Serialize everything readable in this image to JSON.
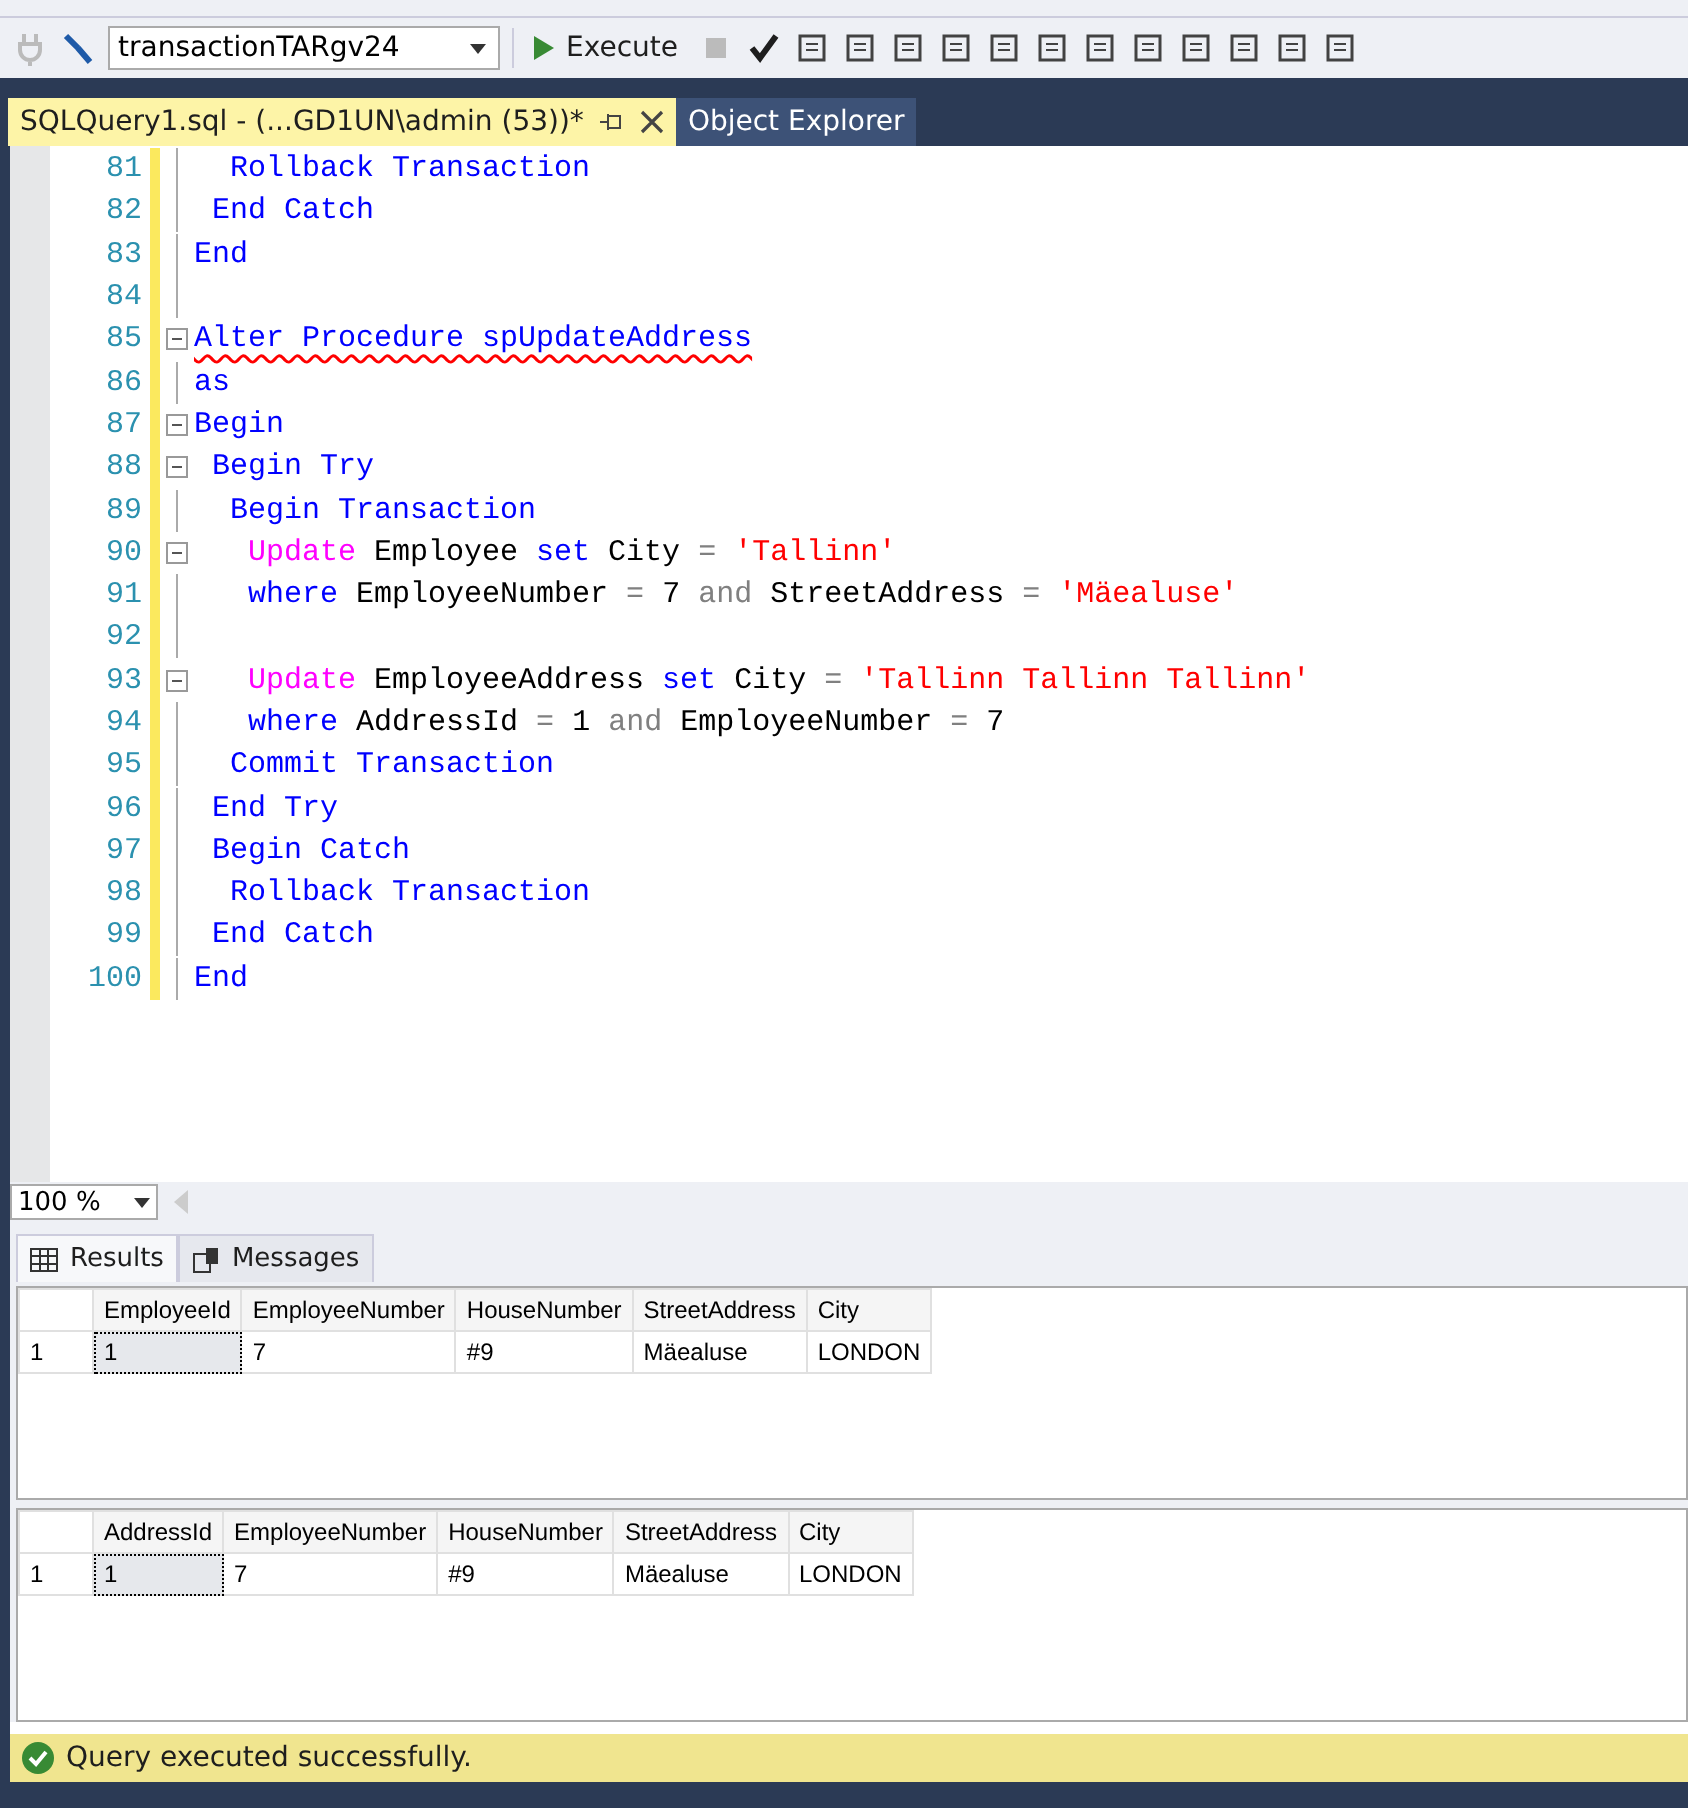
{
  "toolbar": {
    "database": "transactionTARgv24",
    "execute": "Execute"
  },
  "tabs": [
    {
      "label": "SQLQuery1.sql - (...GD1UN\\admin (53))*",
      "selected": true
    },
    {
      "label": "Object Explorer",
      "selected": false
    }
  ],
  "editor": {
    "lines": [
      {
        "number": "81",
        "fold": false,
        "tokens": [
          {
            "text": "  Rollback Transaction",
            "kind": "keyword"
          }
        ]
      },
      {
        "number": "82",
        "fold": false,
        "tokens": [
          {
            "text": " End Catch",
            "kind": "keyword"
          }
        ]
      },
      {
        "number": "83",
        "fold": false,
        "tokens": [
          {
            "text": "End",
            "kind": "keyword"
          }
        ]
      },
      {
        "number": "84",
        "fold": false
      },
      {
        "number": "85",
        "fold": true,
        "tokens": [
          {
            "text": "Alter Procedure spUpdateAddress",
            "kind": "keyword",
            "error": true
          }
        ]
      },
      {
        "number": "86",
        "fold": false,
        "tokens": [
          {
            "text": "as",
            "kind": "keyword"
          }
        ]
      },
      {
        "number": "87",
        "fold": true,
        "tokens": [
          {
            "text": "Begin",
            "kind": "keyword"
          }
        ]
      },
      {
        "number": "88",
        "fold": true,
        "tokens": [
          {
            "text": " Begin Try",
            "kind": "keyword"
          }
        ]
      },
      {
        "number": "89",
        "fold": false,
        "tokens": [
          {
            "text": "  Begin Transaction",
            "kind": "keyword"
          }
        ]
      },
      {
        "number": "90",
        "fold": true,
        "tokens": [
          {
            "text": "   Update",
            "kind": "function"
          },
          {
            "text": " Employee ",
            "kind": "plain"
          },
          {
            "text": "set",
            "kind": "keyword"
          },
          {
            "text": " City ",
            "kind": "plain"
          },
          {
            "text": "=",
            "kind": "operator"
          },
          {
            "text": " 'Tallinn'",
            "kind": "string"
          }
        ]
      },
      {
        "number": "91",
        "fold": false,
        "tokens": [
          {
            "text": "   where",
            "kind": "keyword"
          },
          {
            "text": " EmployeeNumber ",
            "kind": "plain"
          },
          {
            "text": "=",
            "kind": "operator"
          },
          {
            "text": " 7 ",
            "kind": "plain"
          },
          {
            "text": "and",
            "kind": "operator"
          },
          {
            "text": " StreetAddress ",
            "kind": "plain"
          },
          {
            "text": "=",
            "kind": "operator"
          },
          {
            "text": " 'Mäealuse'",
            "kind": "string"
          }
        ]
      },
      {
        "number": "92",
        "fold": false
      },
      {
        "number": "93",
        "fold": true,
        "tokens": [
          {
            "text": "   Update",
            "kind": "function"
          },
          {
            "text": " EmployeeAddress ",
            "kind": "plain"
          },
          {
            "text": "set",
            "kind": "keyword"
          },
          {
            "text": " City ",
            "kind": "plain"
          },
          {
            "text": "=",
            "kind": "operator"
          },
          {
            "text": " 'Tallinn Tallinn Tallinn'",
            "kind": "string"
          }
        ]
      },
      {
        "number": "94",
        "fold": false,
        "tokens": [
          {
            "text": "   where",
            "kind": "keyword"
          },
          {
            "text": " AddressId ",
            "kind": "plain"
          },
          {
            "text": "=",
            "kind": "operator"
          },
          {
            "text": " 1 ",
            "kind": "plain"
          },
          {
            "text": "and",
            "kind": "operator"
          },
          {
            "text": " EmployeeNumber ",
            "kind": "plain"
          },
          {
            "text": "=",
            "kind": "operator"
          },
          {
            "text": " 7",
            "kind": "plain"
          }
        ]
      },
      {
        "number": "95",
        "fold": false,
        "tokens": [
          {
            "text": "  Commit Transaction",
            "kind": "keyword"
          }
        ]
      },
      {
        "number": "96",
        "fold": false,
        "tokens": [
          {
            "text": " End Try",
            "kind": "keyword"
          }
        ]
      },
      {
        "number": "97",
        "fold": false,
        "tokens": [
          {
            "text": " Begin Catch",
            "kind": "keyword"
          }
        ]
      },
      {
        "number": "98",
        "fold": false,
        "tokens": [
          {
            "text": "  Rollback Transaction",
            "kind": "keyword"
          }
        ]
      },
      {
        "number": "99",
        "fold": false,
        "tokens": [
          {
            "text": " End Catch",
            "kind": "keyword"
          }
        ]
      },
      {
        "number": "100",
        "fold": false,
        "tokens": [
          {
            "text": "End",
            "kind": "keyword"
          }
        ]
      }
    ]
  },
  "zoom": "100 %",
  "result_tabs": [
    {
      "label": "Results",
      "selected": true
    },
    {
      "label": "Messages",
      "selected": false
    }
  ],
  "grids": [
    {
      "columns": [
        "EmployeeId",
        "EmployeeNumber",
        "HouseNumber",
        "StreetAddress",
        "City"
      ],
      "rows": [
        {
          "number": "1",
          "cells": [
            "1",
            "7",
            "#9",
            "Mäealuse",
            "LONDON"
          ]
        }
      ]
    },
    {
      "columns": [
        "AddressId",
        "EmployeeNumber",
        "HouseNumber",
        "StreetAddress",
        "City"
      ],
      "rows": [
        {
          "number": "1",
          "cells": [
            "1",
            "7",
            "#9",
            "Mäealuse",
            "LONDON"
          ]
        }
      ]
    }
  ],
  "status_bar": {
    "message": "Query executed successfully."
  }
}
